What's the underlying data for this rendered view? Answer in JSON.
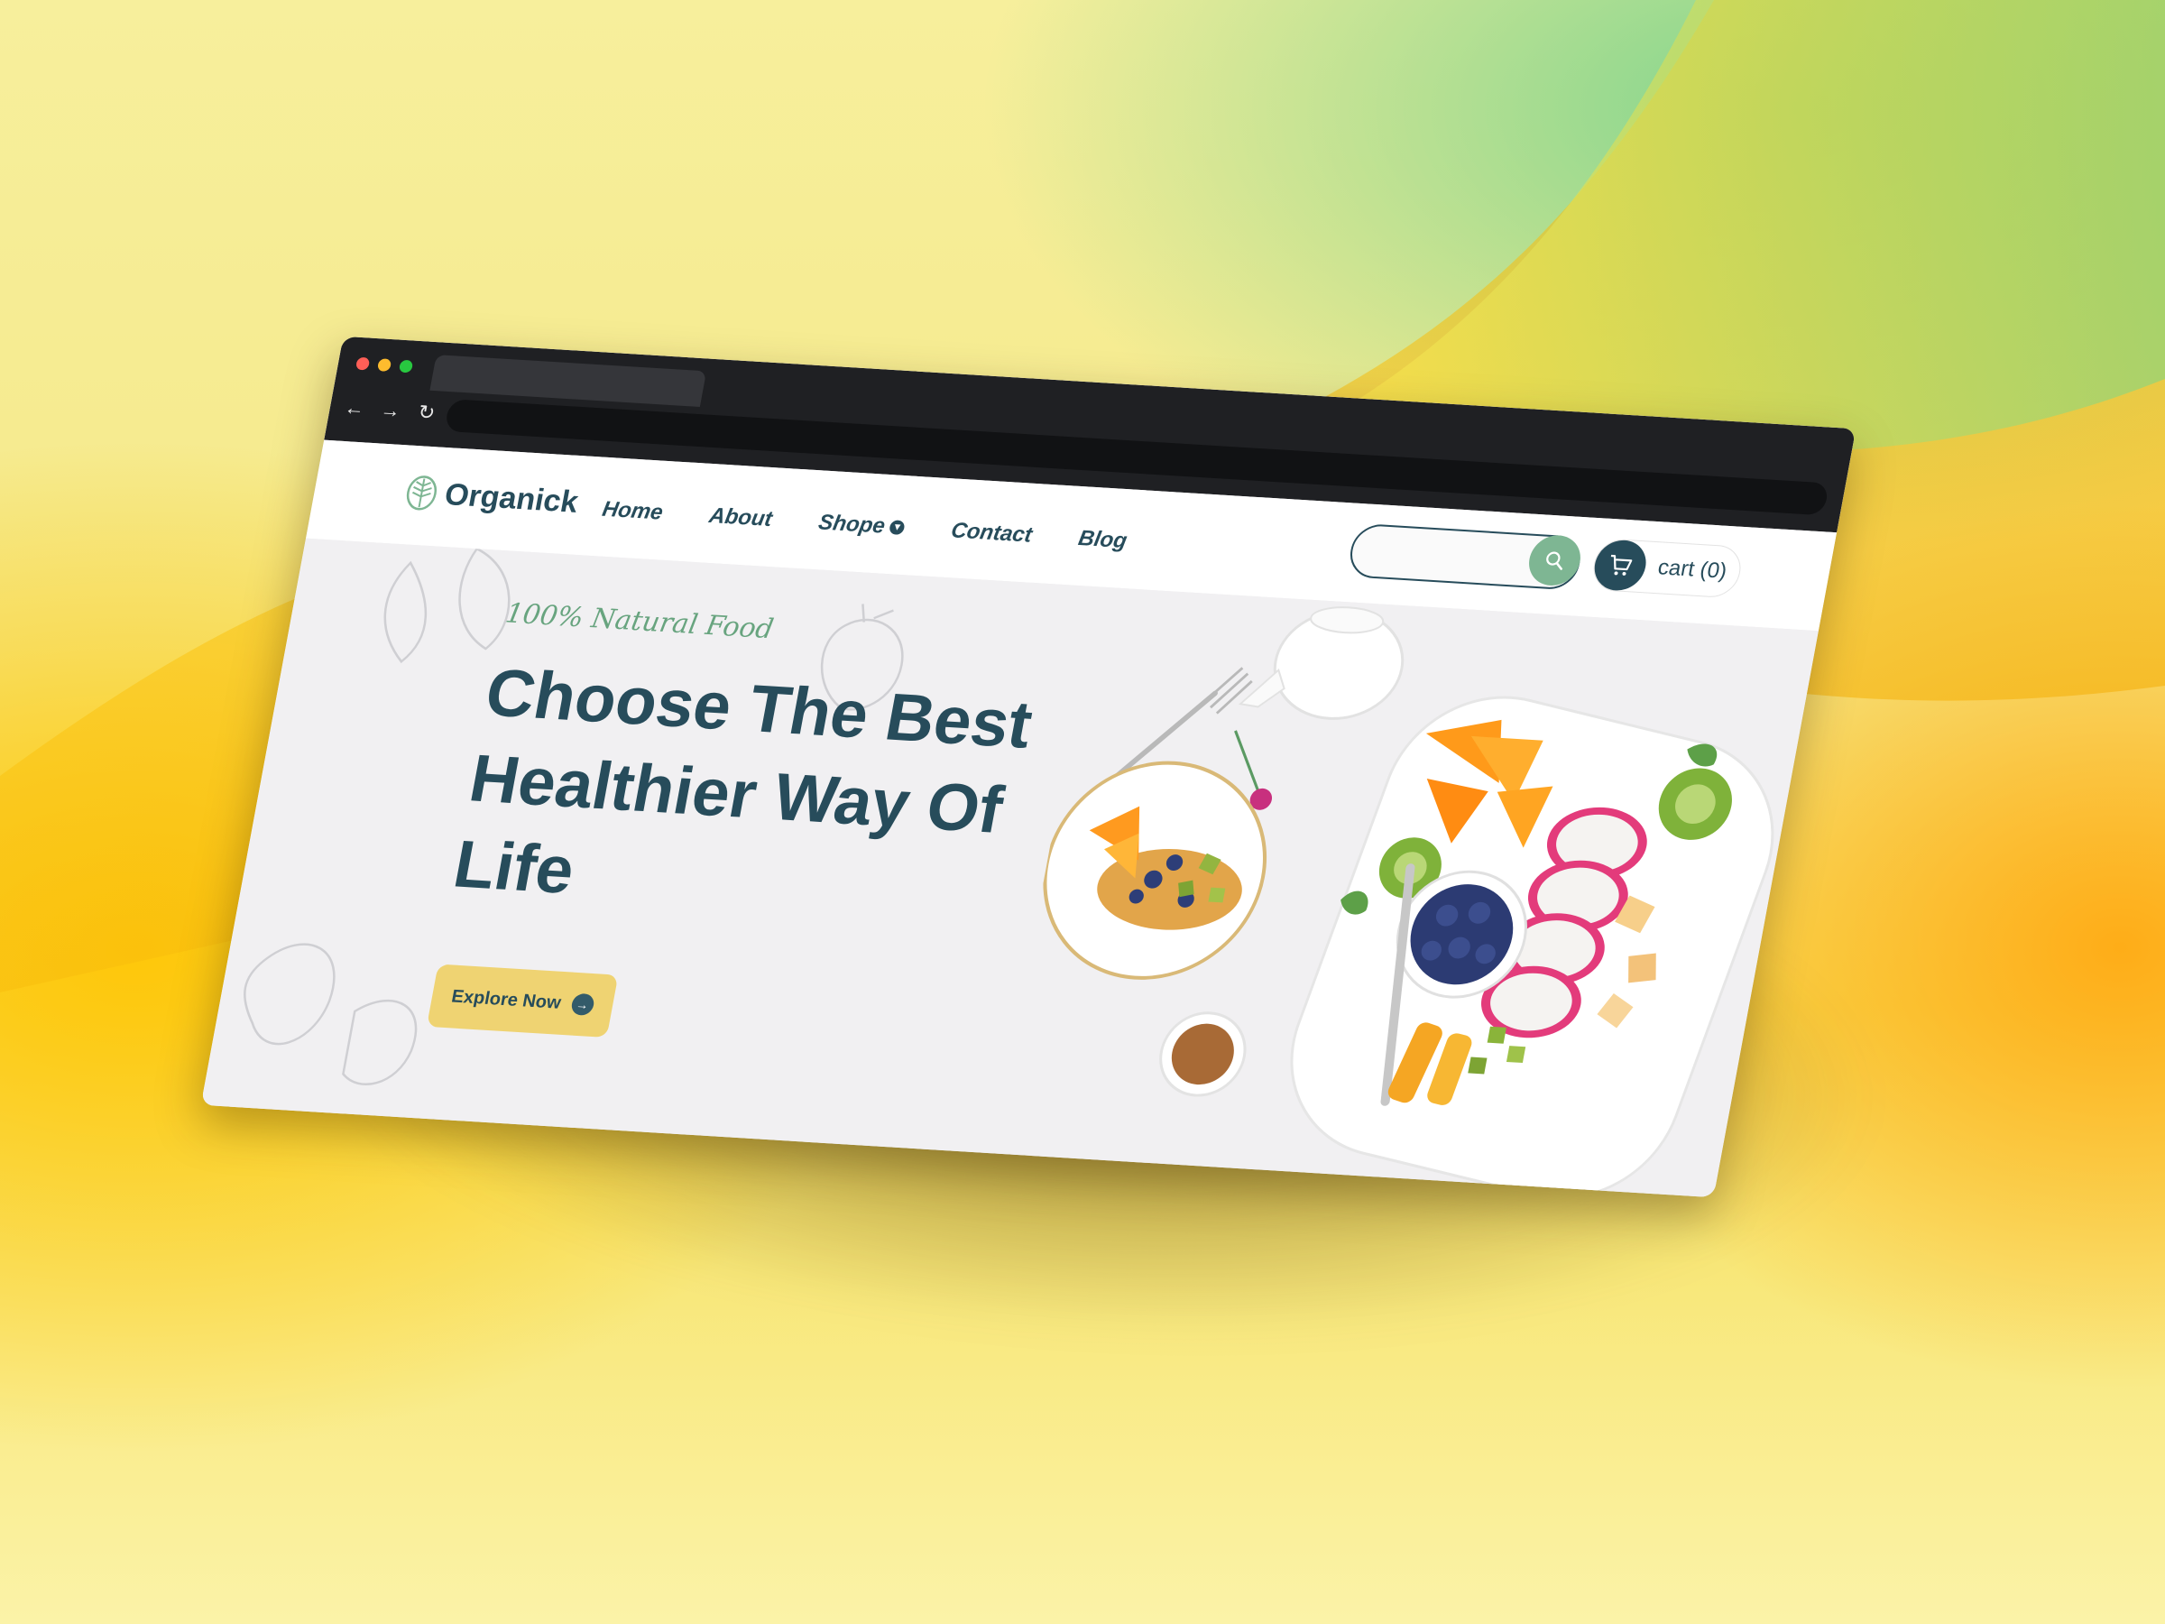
{
  "site": {
    "brand": "Organick",
    "nav": {
      "home": "Home",
      "about": "About",
      "shop": "Shope",
      "contact": "Contact",
      "blog": "Blog"
    },
    "search": {
      "placeholder": ""
    },
    "cart": {
      "label": "cart (0)"
    },
    "hero": {
      "tagline": "100% Natural Food",
      "headline": "Choose The Best Healthier Way Of Life",
      "button": "Explore Now"
    }
  },
  "colors": {
    "brand_dark": "#274c5b",
    "brand_green": "#7eb693",
    "accent_yellow": "#efd372",
    "browser_chrome": "#1f2023"
  },
  "icons": [
    "leaf-logo-icon",
    "chevron-down-icon",
    "search-icon",
    "cart-icon",
    "arrow-right-icon",
    "back-arrow-icon",
    "forward-arrow-icon",
    "reload-icon"
  ]
}
